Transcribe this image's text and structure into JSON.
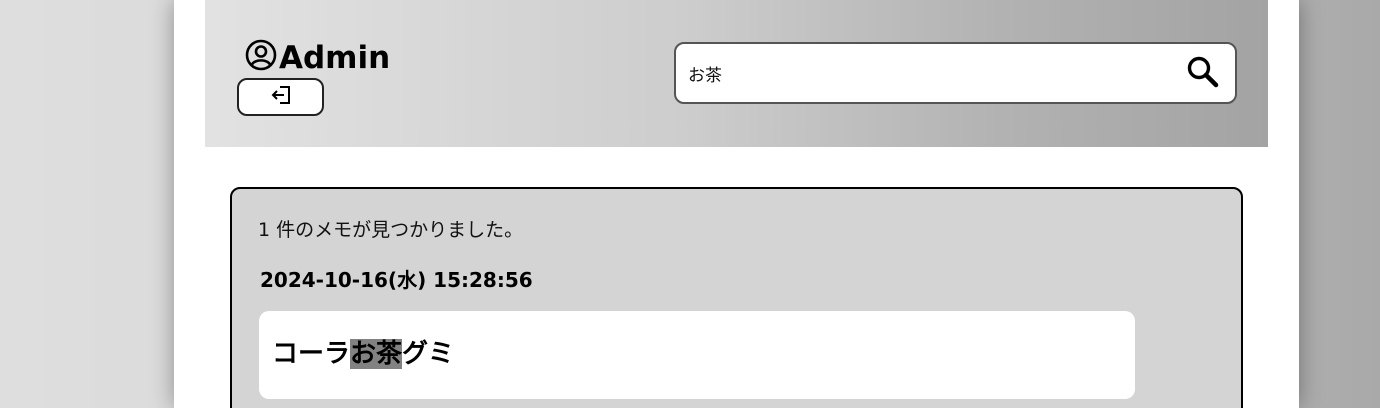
{
  "header": {
    "username": "Admin",
    "user_icon": "user-circle-icon",
    "logout_icon": "logout-icon"
  },
  "search": {
    "query": "お茶",
    "icon": "search-icon"
  },
  "results": {
    "count_message": "1 件のメモが見つかりました。",
    "memos": [
      {
        "date": "2024-10-16(水) 15:28:56",
        "text_before": "コーラ",
        "text_match": "お茶",
        "text_after": "グミ"
      }
    ]
  },
  "colors": {
    "highlight": "#828282",
    "panel": "#d4d4d4"
  }
}
